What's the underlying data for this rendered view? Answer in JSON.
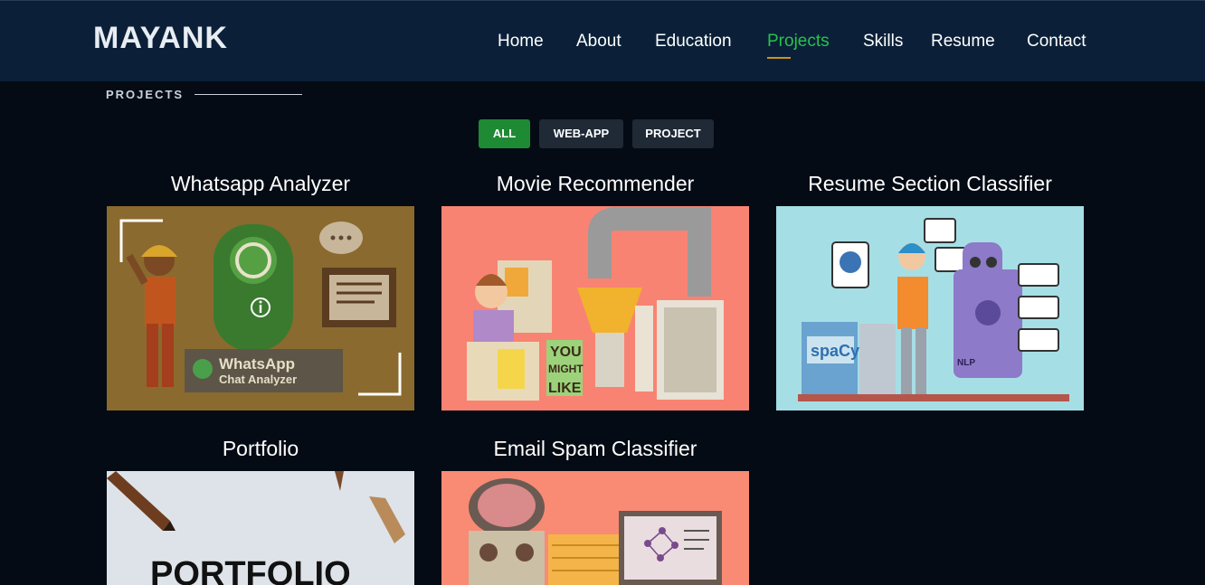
{
  "header": {
    "logo": "MAYANK",
    "nav": [
      {
        "label": "Home",
        "active": false
      },
      {
        "label": "About",
        "active": false
      },
      {
        "label": "Education",
        "active": false
      },
      {
        "label": "Projects",
        "active": true
      },
      {
        "label": "Skills",
        "active": false
      },
      {
        "label": "Resume",
        "active": false
      },
      {
        "label": "Contact",
        "active": false
      }
    ]
  },
  "section": {
    "label": "PROJECTS"
  },
  "filters": [
    {
      "label": "ALL",
      "selected": true
    },
    {
      "label": "WEB-APP",
      "selected": false
    },
    {
      "label": "PROJECT",
      "selected": false
    }
  ],
  "projects": [
    {
      "title": "Whatsapp Analyzer",
      "art_text": [
        "WhatsApp",
        "Chat Analyzer"
      ],
      "hovered": true
    },
    {
      "title": "Movie Recommender",
      "art_text": [
        "YOU",
        "MIGHT",
        "LIKE"
      ]
    },
    {
      "title": "Resume Section Classifier",
      "art_text": [
        "spaCy",
        "NLP"
      ]
    },
    {
      "title": "Portfolio",
      "art_text": [
        "PORTFOLIO"
      ]
    },
    {
      "title": "Email Spam Classifier",
      "art_text": []
    }
  ],
  "colors": {
    "header_bg": "#0b2038",
    "page_bg": "#040b14",
    "accent_green": "#27c24c",
    "filter_active": "#1e8a34",
    "underline": "#c8951a"
  }
}
